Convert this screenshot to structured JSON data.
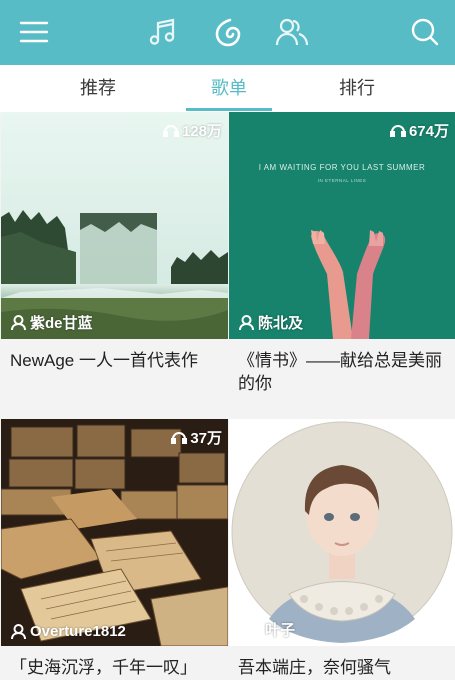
{
  "colors": {
    "accent": "#58bcc6",
    "text": "#222222",
    "tab_text": "#3a3a3a",
    "background": "#f3f3f3"
  },
  "topbar": {
    "icons": [
      "menu-icon",
      "music-note-icon",
      "disc-icon",
      "friends-icon",
      "search-icon"
    ]
  },
  "tabs": [
    {
      "label": "推荐",
      "active": false
    },
    {
      "label": "歌单",
      "active": true
    },
    {
      "label": "排行",
      "active": false
    }
  ],
  "playlists": [
    {
      "plays": "128万",
      "author": "紫de甘蓝",
      "title": "NewAge 一人一首代表作",
      "cover": "misty-forest-lake"
    },
    {
      "plays": "674万",
      "author": "陈北及",
      "title": "《情书》——献给总是美丽的你",
      "cover": "green-hands-poster",
      "cover_text_1": "I AM WAITING FOR YOU LAST SUMMER",
      "cover_text_2": "IN ETERNAL LINES"
    },
    {
      "plays": "37万",
      "author": "Overture1812",
      "title": "「史海沉浮，千年一叹」",
      "cover": "ancient-books"
    },
    {
      "plays": "",
      "author": "叶子",
      "title": "吾本端庄，奈何骚气",
      "cover": "child-portrait"
    }
  ]
}
